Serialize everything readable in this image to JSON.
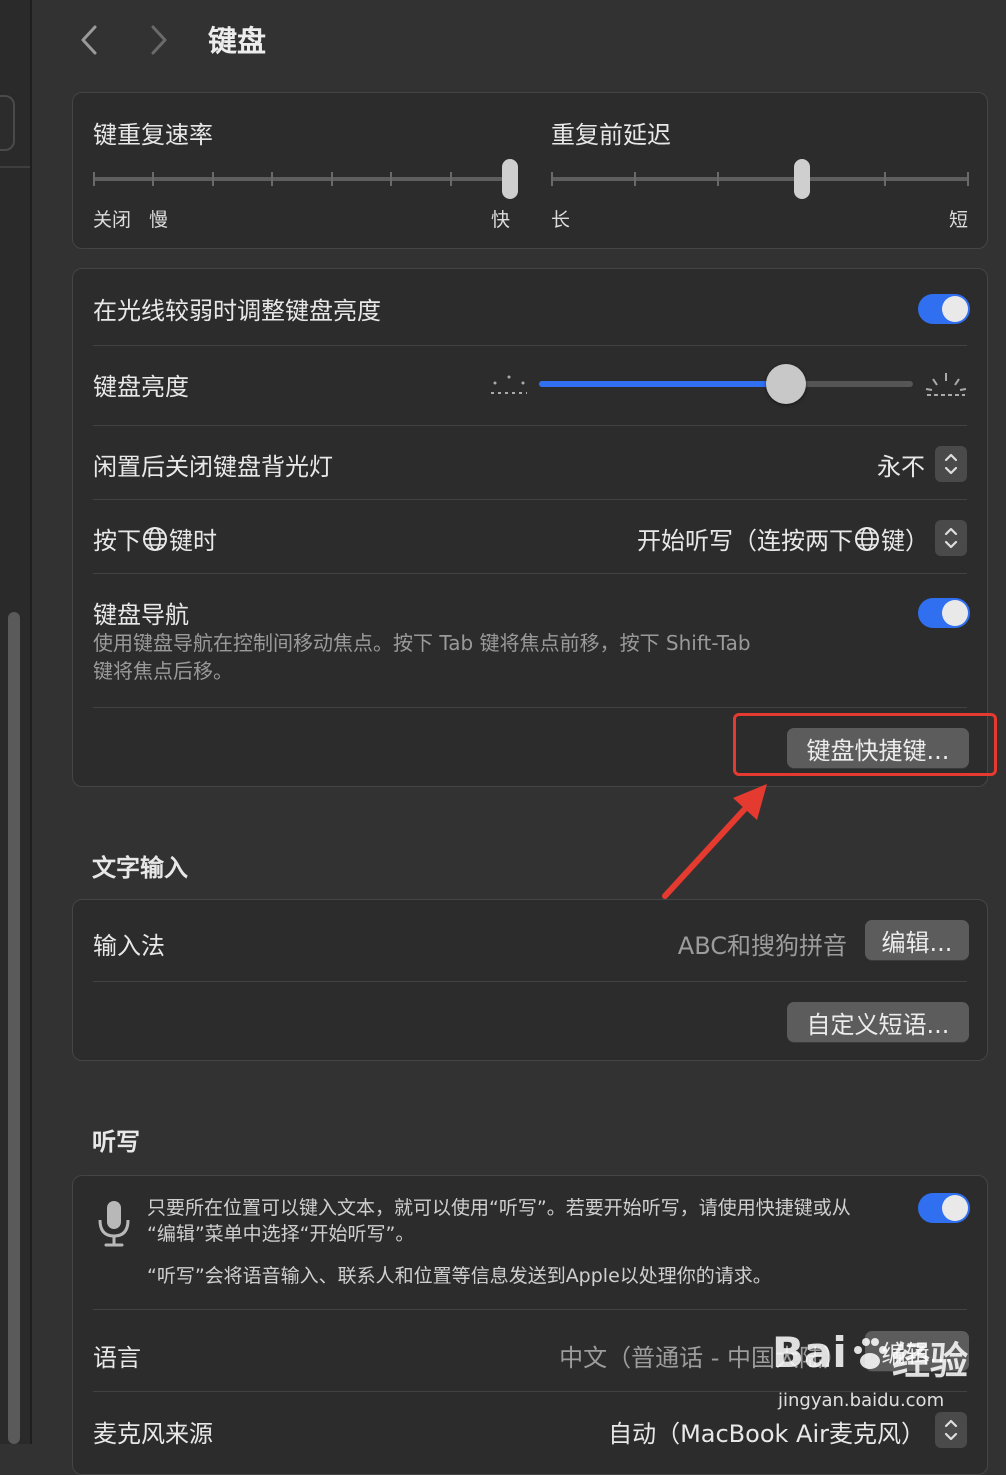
{
  "window": {
    "title": "键盘"
  },
  "nav": {
    "back_icon": "chevron-left-icon",
    "forward_icon": "chevron-right-icon"
  },
  "repeat": {
    "rate_label": "键重复速率",
    "rate_min_off": "关闭",
    "rate_min": "慢",
    "rate_max": "快",
    "rate_value_step": 7,
    "rate_steps": 8,
    "delay_label": "重复前延迟",
    "delay_min": "长",
    "delay_max": "短",
    "delay_value_step": 3,
    "delay_steps": 6
  },
  "backlight": {
    "adjust_label": "在光线较弱时调整键盘亮度",
    "adjust_on": true,
    "brightness_label": "键盘亮度",
    "brightness_value": 0.66,
    "idle_label": "闲置后关闭键盘背光灯",
    "idle_value": "永不",
    "globe_label_pre": "按下",
    "globe_label_post": "键时",
    "globe_value_pre": "开始听写（连按两下",
    "globe_value_post": "键）",
    "nav_label": "键盘导航",
    "nav_desc_line1": "使用键盘导航在控制间移动焦点。按下 Tab 键将焦点前移，按下 Shift-Tab",
    "nav_desc_line2": "键将焦点后移。",
    "nav_on": true,
    "shortcuts_button": "键盘快捷键..."
  },
  "text_input": {
    "section_title": "文字输入",
    "input_label": "输入法",
    "input_value": "ABC和搜狗拼音",
    "edit_button": "编辑...",
    "phrases_button": "自定义短语..."
  },
  "dictation": {
    "section_title": "听写",
    "desc_line1": "只要所在位置可以键入文本，就可以使用“听写”。若要开始听写，请使用快捷键或从",
    "desc_line2": "“编辑”菜单中选择“开始听写”。",
    "privacy": "“听写”会将语音输入、联系人和位置等信息发送到Apple以处理你的请求。",
    "on": true,
    "language_label": "语言",
    "language_value": "中文（普通话 - 中国大陆）",
    "language_edit": "编辑...",
    "mic_label": "麦克风来源",
    "mic_value": "自动（MacBook Air麦克风）"
  },
  "watermark": {
    "brand": "Bai",
    "brand2": "经验",
    "url": "jingyan.baidu.com"
  },
  "colors": {
    "accent": "#2f6ff0",
    "highlight": "#e53a2f",
    "background": "#323232",
    "card": "#2c2c2c"
  }
}
